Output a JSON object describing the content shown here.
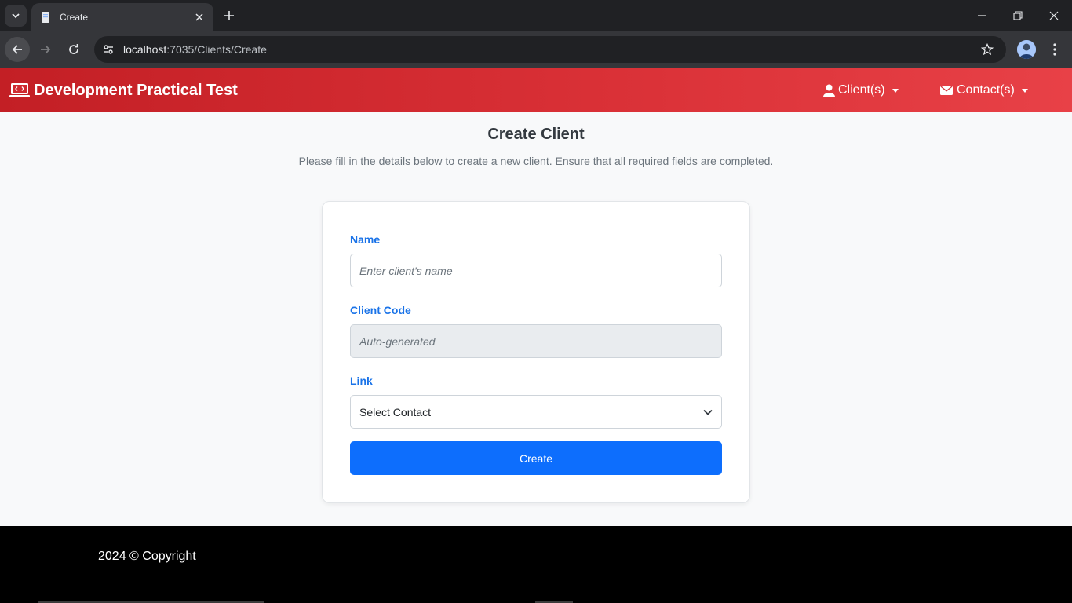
{
  "browser": {
    "tab_title": "Create",
    "url_host": "localhost",
    "url_path": ":7035/Clients/Create"
  },
  "navbar": {
    "brand": "Development Practical Test",
    "items": [
      {
        "label": "Client(s)",
        "icon": "user-icon"
      },
      {
        "label": "Contact(s)",
        "icon": "envelope-icon"
      }
    ]
  },
  "page": {
    "title": "Create Client",
    "subtitle": "Please fill in the details below to create a new client. Ensure that all required fields are completed."
  },
  "form": {
    "name_label": "Name",
    "name_placeholder": "Enter client's name",
    "code_label": "Client Code",
    "code_placeholder": "Auto-generated",
    "link_label": "Link",
    "link_selected": "Select Contact",
    "submit_label": "Create"
  },
  "footer": {
    "text": "2024 © Copyright"
  },
  "colors": {
    "navbar_start": "#c31f25",
    "navbar_end": "#e84147",
    "primary": "#0d6efd",
    "label_blue": "#1a73e8"
  }
}
